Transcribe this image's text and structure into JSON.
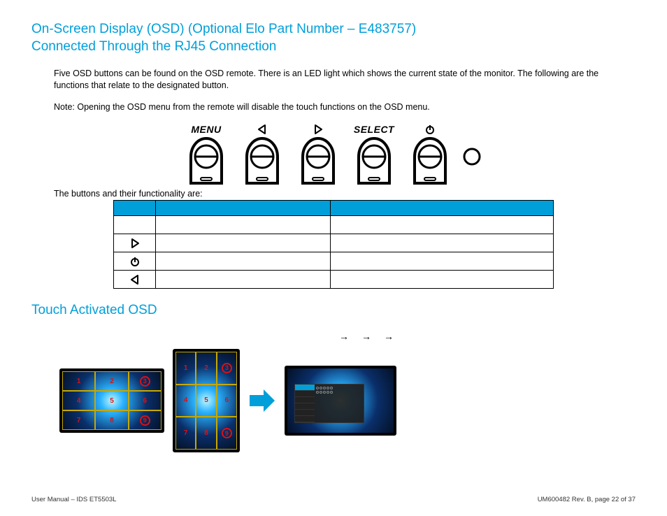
{
  "heading1_line1": "On-Screen Display (OSD) (Optional Elo Part Number – E483757)",
  "heading1_line2": "Connected Through the RJ45 Connection",
  "para1": "Five OSD buttons can be found on the OSD remote. There is an LED light which shows the current state of the monitor. The following are the functions that relate to the designated button.",
  "para2": "Note: Opening the OSD menu from the remote will disable the touch functions on the OSD menu.",
  "osd_labels": {
    "menu": "MENU",
    "select": "SELECT"
  },
  "table_intro": "The buttons and their functionality are:",
  "heading2": "Touch Activated OSD",
  "arrows": [
    "→",
    "→",
    "→"
  ],
  "grid_nums": [
    "1",
    "2",
    "3",
    "4",
    "5",
    "6",
    "7",
    "8",
    "9"
  ],
  "footer_left": "User Manual – IDS ET5503L",
  "footer_right": "UM600482 Rev. B, page 22 of 37"
}
